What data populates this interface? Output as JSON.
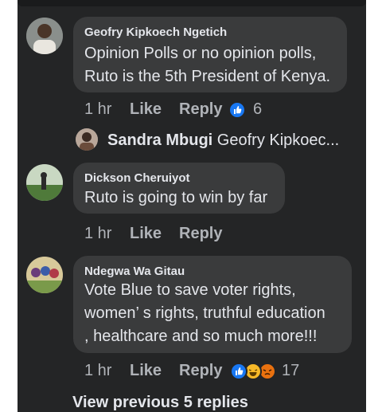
{
  "comments": [
    {
      "author": "Geofry Kipkoech Ngetich",
      "text": "Opinion Polls or no opinion polls,\nRuto is the 5th President of Kenya.",
      "time": "1 hr",
      "like_label": "Like",
      "reply_label": "Reply",
      "reaction_count": "6",
      "reactions": [
        "like-icon"
      ]
    },
    {
      "author": "Dickson Cheruiyot",
      "text": "Ruto is going to win by far",
      "time": "1 hr",
      "like_label": "Like",
      "reply_label": "Reply"
    },
    {
      "author": "Ndegwa Wa Gitau",
      "text": "Vote Blue to save voter rights,\nwomen’ s rights, truthful education\n, healthcare and so much more!!!",
      "time": "1 hr",
      "like_label": "Like",
      "reply_label": "Reply",
      "reaction_count": "17",
      "reactions": [
        "like-icon",
        "haha-icon",
        "angry-icon"
      ]
    }
  ],
  "reply_preview": {
    "author": "Sandra Mbugi",
    "text": "Geofry Kipkoec..."
  },
  "view_previous": "View previous 5 replies",
  "colors": {
    "background": "#242526",
    "bubble": "#3a3b3c",
    "meta": "#b0b3b8",
    "like_blue": "#1877f2",
    "haha_yellow": "#f7b928",
    "angry_orange": "#e9710f"
  }
}
